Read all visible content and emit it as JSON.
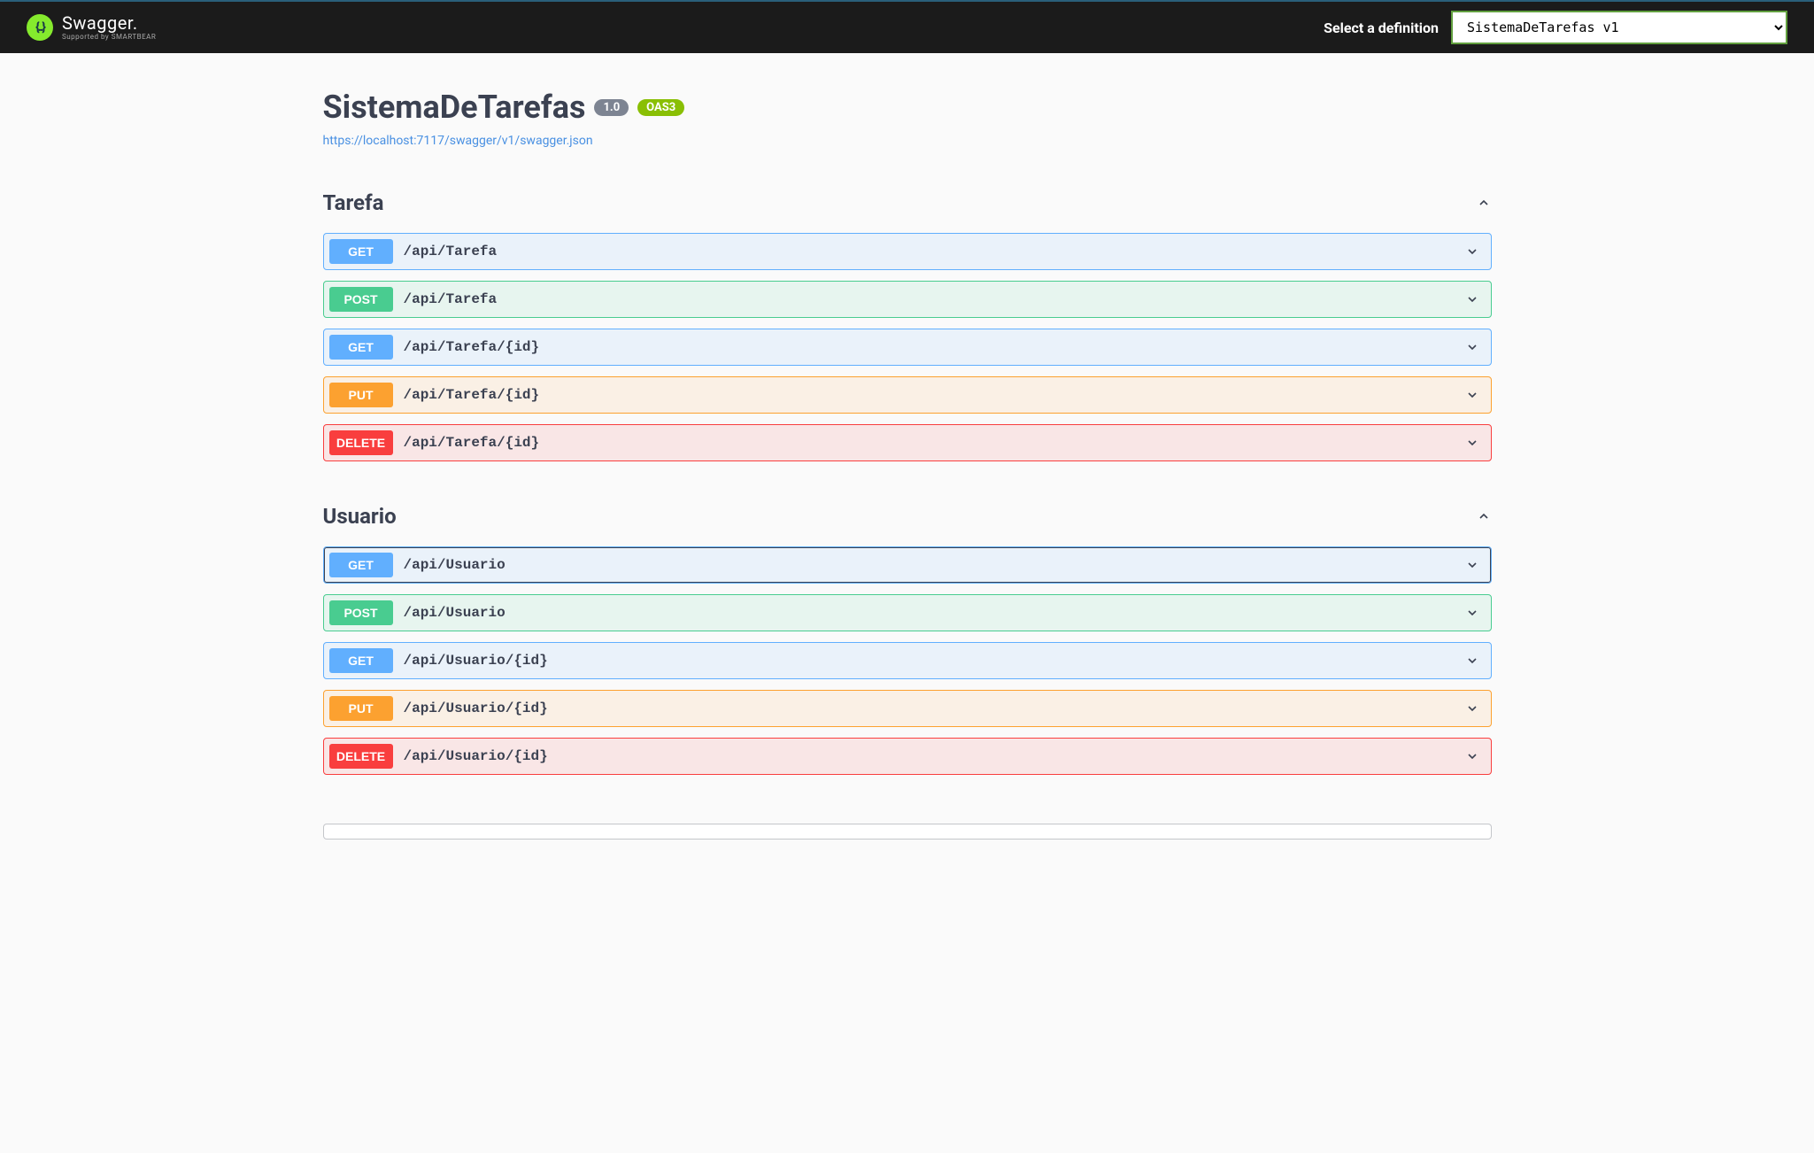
{
  "topbar": {
    "brand": "Swagger.",
    "sub": "Supported by SMARTBEAR",
    "logo_glyph": "{..}",
    "def_label": "Select a definition",
    "def_value": "SistemaDeTarefas v1"
  },
  "info": {
    "title": "SistemaDeTarefas",
    "version": "1.0",
    "oas": "OAS3",
    "spec_url": "https://localhost:7117/swagger/v1/swagger.json"
  },
  "tags": [
    {
      "name": "Tarefa",
      "ops": [
        {
          "method": "GET",
          "path": "/api/Tarefa",
          "cls": "op-get",
          "focused": false
        },
        {
          "method": "POST",
          "path": "/api/Tarefa",
          "cls": "op-post",
          "focused": false
        },
        {
          "method": "GET",
          "path": "/api/Tarefa/{id}",
          "cls": "op-get",
          "focused": false
        },
        {
          "method": "PUT",
          "path": "/api/Tarefa/{id}",
          "cls": "op-put",
          "focused": false
        },
        {
          "method": "DELETE",
          "path": "/api/Tarefa/{id}",
          "cls": "op-delete",
          "focused": false
        }
      ]
    },
    {
      "name": "Usuario",
      "ops": [
        {
          "method": "GET",
          "path": "/api/Usuario",
          "cls": "op-get",
          "focused": true
        },
        {
          "method": "POST",
          "path": "/api/Usuario",
          "cls": "op-post",
          "focused": false
        },
        {
          "method": "GET",
          "path": "/api/Usuario/{id}",
          "cls": "op-get",
          "focused": false
        },
        {
          "method": "PUT",
          "path": "/api/Usuario/{id}",
          "cls": "op-put",
          "focused": false
        },
        {
          "method": "DELETE",
          "path": "/api/Usuario/{id}",
          "cls": "op-delete",
          "focused": false
        }
      ]
    }
  ]
}
